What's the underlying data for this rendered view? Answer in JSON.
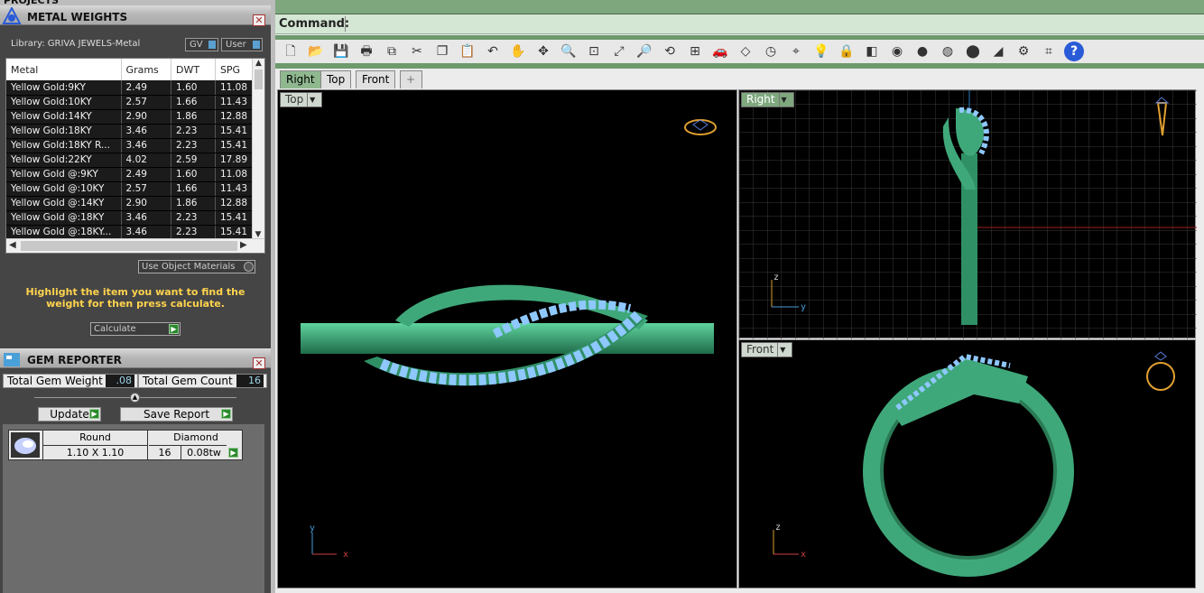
{
  "projects_tab": "PROJECTS",
  "metal_panel": {
    "title": "METAL WEIGHTS",
    "library": "Library: GRIVA JEWELS-Metal",
    "gv_label": "GV",
    "user_label": "User",
    "columns": [
      "Metal",
      "Grams",
      "DWT",
      "SPG"
    ],
    "rows": [
      [
        "Yellow Gold:9KY",
        "2.49",
        "1.60",
        "11.08"
      ],
      [
        "Yellow Gold:10KY",
        "2.57",
        "1.66",
        "11.43"
      ],
      [
        "Yellow Gold:14KY",
        "2.90",
        "1.86",
        "12.88"
      ],
      [
        "Yellow Gold:18KY",
        "3.46",
        "2.23",
        "15.41"
      ],
      [
        "Yellow Gold:18KY R...",
        "3.46",
        "2.23",
        "15.41"
      ],
      [
        "Yellow Gold:22KY",
        "4.02",
        "2.59",
        "17.89"
      ],
      [
        "Yellow Gold @:9KY",
        "2.49",
        "1.60",
        "11.08"
      ],
      [
        "Yellow Gold @:10KY",
        "2.57",
        "1.66",
        "11.43"
      ],
      [
        "Yellow Gold @:14KY",
        "2.90",
        "1.86",
        "12.88"
      ],
      [
        "Yellow Gold @:18KY",
        "3.46",
        "2.23",
        "15.41"
      ],
      [
        "Yellow Gold @:18KY...",
        "3.46",
        "2.23",
        "15.41"
      ]
    ],
    "use_object_materials": "Use Object Materials",
    "hint": "Highlight the item you want to find the weight for then press calculate.",
    "calculate": "Calculate"
  },
  "gem_panel": {
    "title": "GEM REPORTER",
    "total_weight_label": "Total Gem Weight",
    "total_weight": ".08",
    "total_count_label": "Total Gem Count",
    "total_count": "16",
    "update": "Update",
    "save_report": "Save Report",
    "gem": {
      "shape": "Round",
      "size": "1.10 X 1.10",
      "stone": "Diamond",
      "count": "16",
      "weight": "0.08tw"
    }
  },
  "command_label": "Command:",
  "tabs": [
    "Right",
    "Top",
    "Front",
    "+"
  ],
  "viewports": {
    "top": "Top",
    "right": "Right",
    "front": "Front"
  },
  "axes": {
    "x": "x",
    "y": "y",
    "z": "z"
  },
  "colors": {
    "ring": "#3fa87a",
    "gem": "#7fb7ff",
    "accent": "#ffd34d"
  }
}
